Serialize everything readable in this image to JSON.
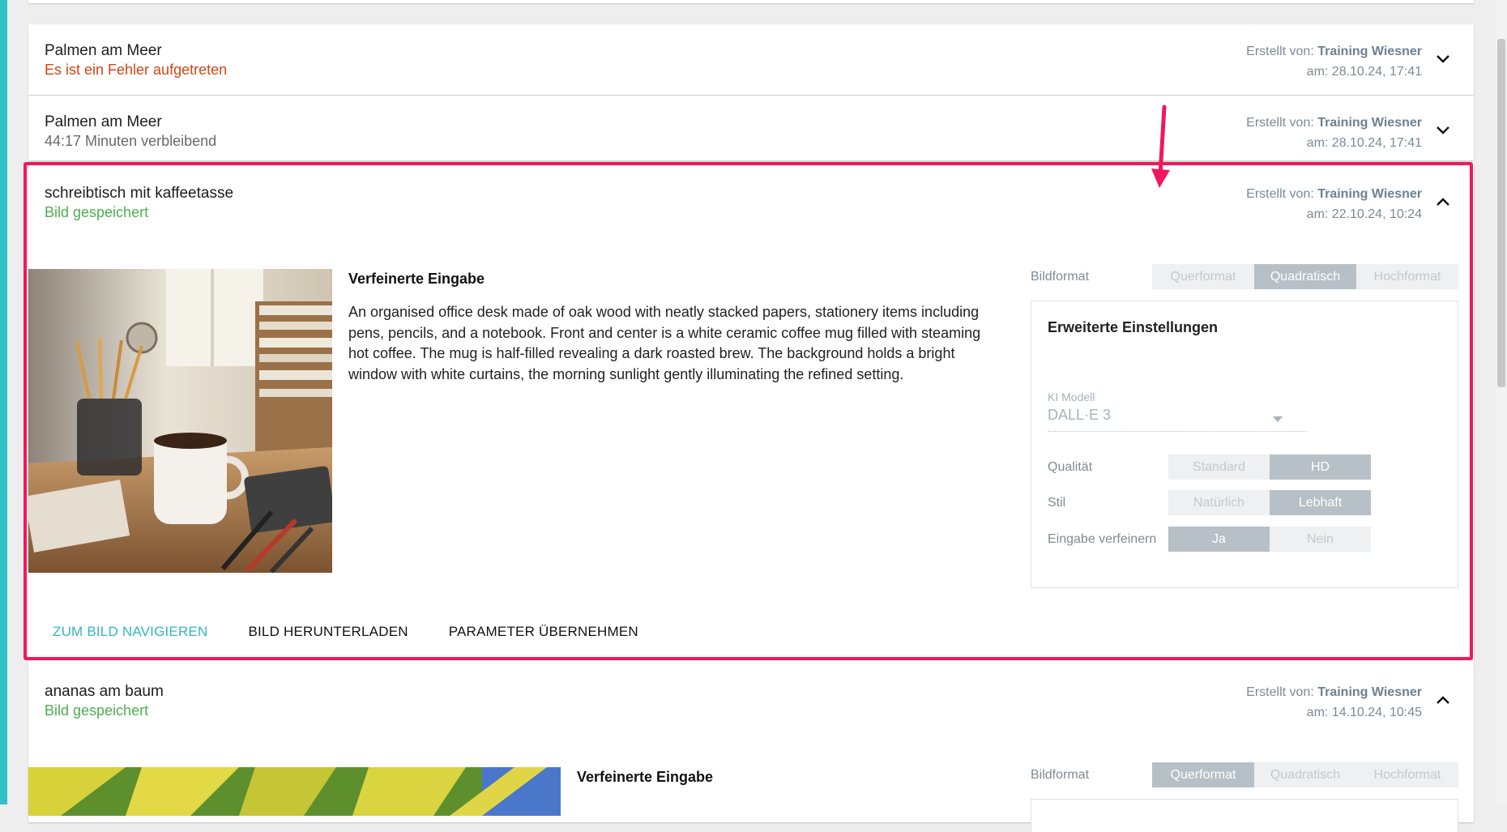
{
  "items": [
    {
      "title": "Palmen am Meer",
      "status": "Es ist ein Fehler aufgetreten",
      "created_by_label": "Erstellt von:",
      "author": "Training Wiesner",
      "date": "am: 28.10.24, 17:41"
    },
    {
      "title": "Palmen am Meer",
      "status": "44:17 Minuten verbleibend",
      "created_by_label": "Erstellt von:",
      "author": "Training Wiesner",
      "date": "am: 28.10.24, 17:41"
    },
    {
      "title": "schreibtisch mit kaffeetasse",
      "status": "Bild gespeichert",
      "created_by_label": "Erstellt von:",
      "author": "Training Wiesner",
      "date": "am: 22.10.24, 10:24",
      "refined_heading": "Verfeinerte Eingabe",
      "refined_text": "An organised office desk made of oak wood with neatly stacked papers, stationery items including pens, pencils, and a notebook. Front and center is a white ceramic coffee mug filled with steaming hot coffee. The mug is half-filled revealing a dark roasted brew. The background holds a bright window with white curtains, the morning sunlight gently illuminating the refined setting.",
      "format_label": "Bildformat",
      "formats": [
        "Querformat",
        "Quadratisch",
        "Hochformat"
      ],
      "format_selected": "Quadratisch",
      "settings": {
        "title": "Erweiterte Einstellungen",
        "model_label": "KI Modell",
        "model_value": "DALL·E 3",
        "quality_label": "Qualität",
        "quality_options": [
          "Standard",
          "HD"
        ],
        "style_label": "Stil",
        "style_options": [
          "Natürlich",
          "Lebhaft"
        ],
        "refine_label": "Eingabe verfeinern",
        "refine_options": [
          "Ja",
          "Nein"
        ]
      },
      "actions": [
        "ZUM BILD NAVIGIEREN",
        "BILD HERUNTERLADEN",
        "PARAMETER ÜBERNEHMEN"
      ]
    },
    {
      "title": "ananas am baum",
      "status": "Bild gespeichert",
      "created_by_label": "Erstellt von:",
      "author": "Training Wiesner",
      "date": "am: 14.10.24, 10:45",
      "refined_heading": "Verfeinerte Eingabe",
      "format_label": "Bildformat",
      "formats": [
        "Querformat",
        "Quadratisch",
        "Hochformat"
      ],
      "format_selected": "Querformat"
    }
  ],
  "colors": {
    "accent": "#33c1c8",
    "highlight": "#f0185d",
    "error": "#d34515",
    "success": "#4caf50"
  }
}
